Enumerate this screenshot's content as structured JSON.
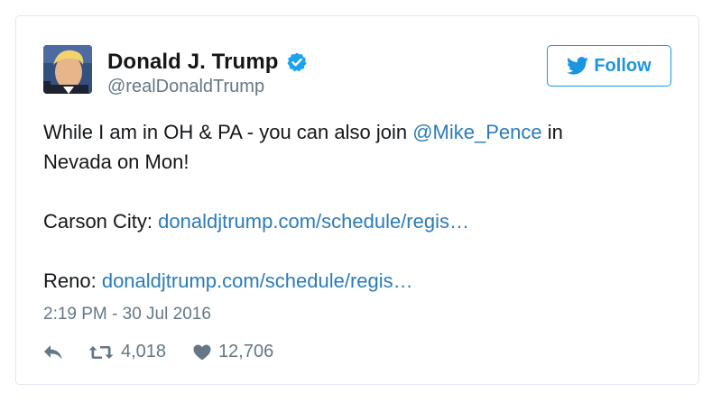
{
  "user": {
    "display_name": "Donald J. Trump",
    "handle": "@realDonaldTrump",
    "verified": true,
    "avatar": "profile-photo"
  },
  "follow_button": {
    "label": "Follow",
    "icon": "twitter-bird-icon"
  },
  "tweet": {
    "line1_text": "While I am in OH & PA - you can also join ",
    "mention": "@Mike_Pence",
    "line1_tail": " in",
    "line2_text": "Nevada on Mon!",
    "carson_label": "Carson City: ",
    "carson_link": "donaldjtrump.com/schedule/regis…",
    "reno_label": "Reno: ",
    "reno_link": "donaldjtrump.com/schedule/regis…"
  },
  "timestamp": "2:19 PM - 30 Jul 2016",
  "stats": {
    "retweets": "4,018",
    "likes": "12,706"
  },
  "colors": {
    "link": "#2b7bb9",
    "follow_blue": "#1b95e0",
    "muted": "#657786",
    "verified_badge": "#1da1f2",
    "border": "#e1e8ed"
  }
}
